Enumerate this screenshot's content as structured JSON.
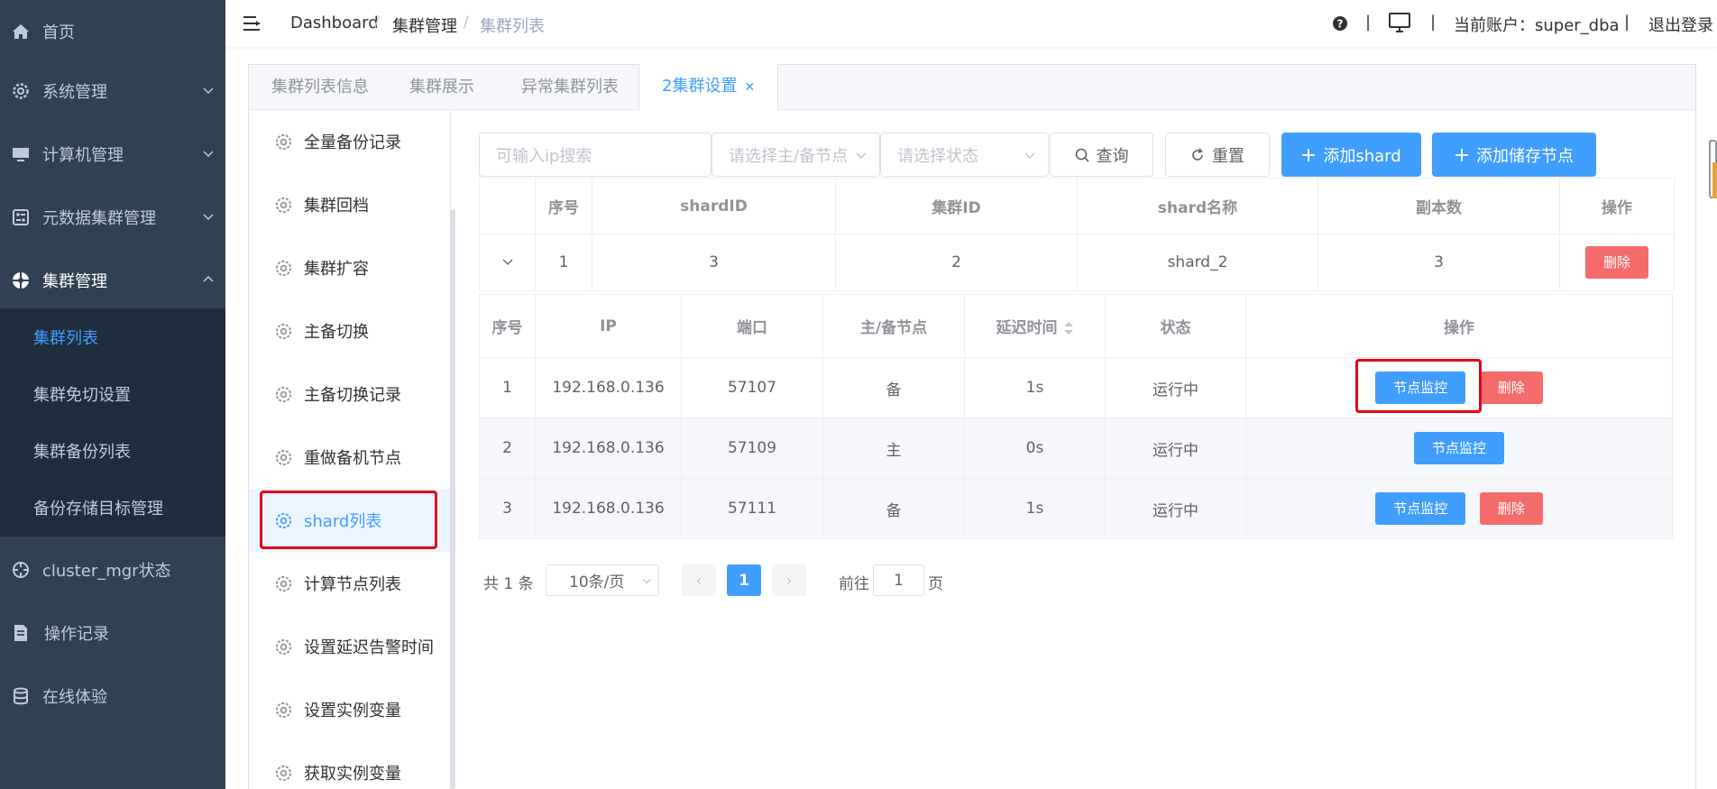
{
  "sidebar": {
    "items": [
      {
        "label": "首页",
        "icon": "home-icon"
      },
      {
        "label": "系统管理",
        "icon": "gear-icon"
      },
      {
        "label": "计算机管理",
        "icon": "monitor-icon"
      },
      {
        "label": "元数据集群管理",
        "icon": "database-panel-icon"
      },
      {
        "label": "集群管理",
        "icon": "cluster-icon"
      },
      {
        "label": "cluster_mgr状态",
        "icon": "crosshair-icon"
      },
      {
        "label": "操作记录",
        "icon": "document-icon"
      },
      {
        "label": "在线体验",
        "icon": "database-icon"
      }
    ],
    "subitems": [
      "集群列表",
      "集群免切设置",
      "集群备份列表",
      "备份存储目标管理"
    ]
  },
  "header": {
    "breadcrumb": [
      "Dashboard",
      "集群管理",
      "集群列表"
    ],
    "account": "当前账户：super_dba",
    "logout": "退出登录",
    "help_icon": "question-icon",
    "screen_icon": "screen-icon"
  },
  "tabs": [
    "集群列表信息",
    "集群展示",
    "异常集群列表",
    "2集群设置"
  ],
  "leftmenu": [
    "全量备份记录",
    "集群回档",
    "集群扩容",
    "主备切换",
    "主备切换记录",
    "重做备机节点",
    "shard列表",
    "计算节点列表",
    "设置延迟告警时间",
    "设置实例变量",
    "获取实例变量"
  ],
  "filters": {
    "ip_placeholder": "可输入ip搜索",
    "node_placeholder": "请选择主/备节点",
    "status_placeholder": "请选择状态",
    "search": "查询",
    "reset": "重置",
    "add_shard": "添加shard",
    "add_storage": "添加储存节点"
  },
  "shard_table": {
    "headers": [
      "序号",
      "shardID",
      "集群ID",
      "shard名称",
      "副本数",
      "操作"
    ],
    "row": {
      "index": "1",
      "shard_id": "3",
      "cluster_id": "2",
      "name": "shard_2",
      "replicas": "3",
      "delete": "删除"
    }
  },
  "node_table": {
    "headers": [
      "序号",
      "IP",
      "端口",
      "主/备节点",
      "延迟时间",
      "状态",
      "操作"
    ],
    "rows": [
      {
        "index": "1",
        "ip": "192.168.0.136",
        "port": "57107",
        "role": "备",
        "delay": "1s",
        "status": "运行中",
        "monitor": "节点监控",
        "delete": "删除"
      },
      {
        "index": "2",
        "ip": "192.168.0.136",
        "port": "57109",
        "role": "主",
        "delay": "0s",
        "status": "运行中",
        "monitor": "节点监控",
        "delete": ""
      },
      {
        "index": "3",
        "ip": "192.168.0.136",
        "port": "57111",
        "role": "备",
        "delay": "1s",
        "status": "运行中",
        "monitor": "节点监控",
        "delete": "删除"
      }
    ]
  },
  "pagination": {
    "total": "共 1 条",
    "page_size": "10条/页",
    "current": "1",
    "goto": "前往",
    "goto_value": "1",
    "page_unit": "页"
  },
  "colors": {
    "sidebar": "#304156",
    "submenu": "#1f2d3d",
    "primary": "#409eff",
    "danger": "#f56c6c",
    "success": "#67c23a",
    "highlight": "#e60012"
  }
}
